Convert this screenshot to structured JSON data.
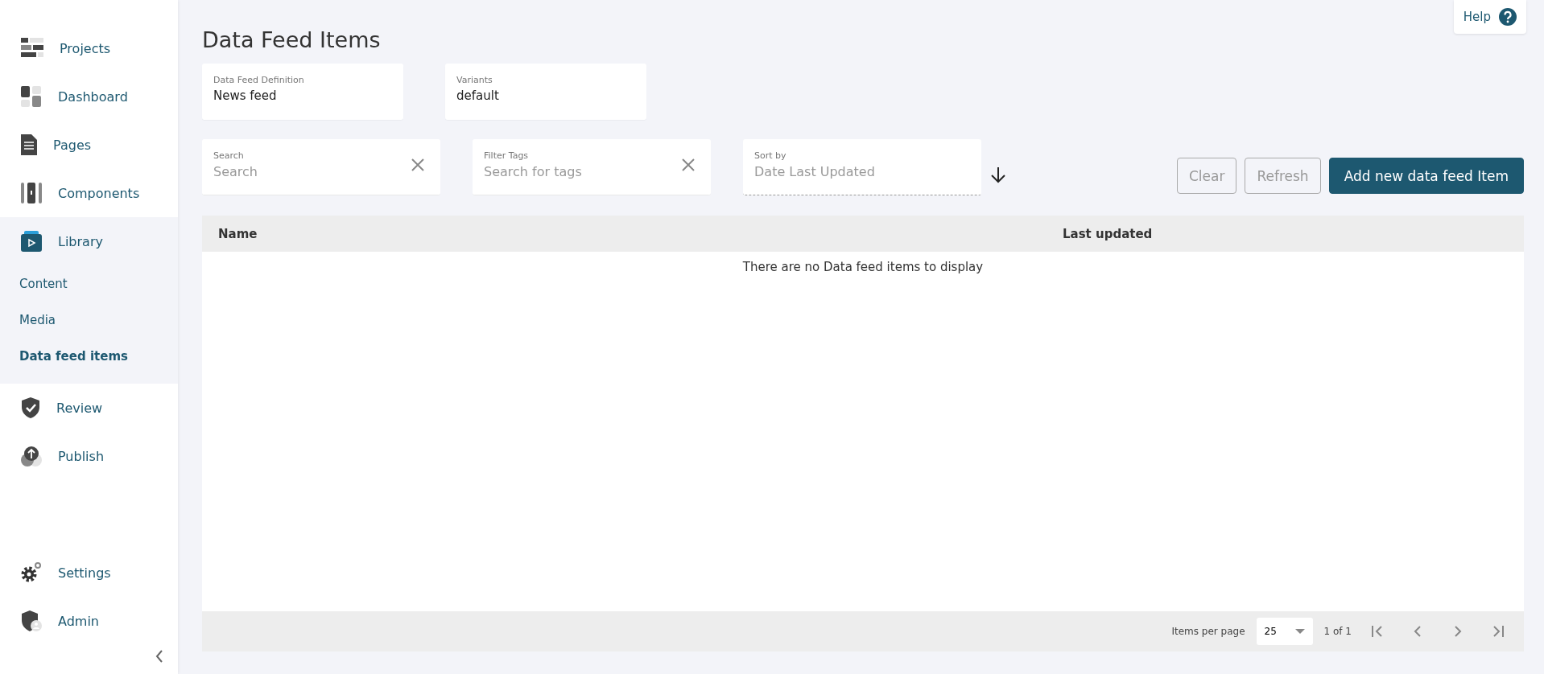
{
  "sidebar": {
    "items": [
      {
        "label": "Projects",
        "expanded": false
      },
      {
        "label": "Dashboard",
        "expanded": false
      },
      {
        "label": "Pages",
        "expanded": false
      },
      {
        "label": "Components",
        "expanded": false
      },
      {
        "label": "Library",
        "expanded": true,
        "children": [
          {
            "label": "Content",
            "selected": false
          },
          {
            "label": "Media",
            "selected": false
          },
          {
            "label": "Data feed items",
            "selected": true
          }
        ]
      },
      {
        "label": "Review",
        "expanded": false
      },
      {
        "label": "Publish",
        "expanded": false
      }
    ],
    "bottom_items": [
      {
        "label": "Settings"
      },
      {
        "label": "Admin"
      }
    ]
  },
  "help": {
    "label": "Help"
  },
  "title": "Data Feed Items",
  "selectors": [
    {
      "label": "Data Feed Definition",
      "value": "News feed"
    },
    {
      "label": "Variants",
      "value": "default"
    }
  ],
  "filters": [
    {
      "kind": "search",
      "label": "Search",
      "placeholder": "Search"
    },
    {
      "kind": "search",
      "label": "Filter Tags",
      "placeholder": "Search for tags"
    },
    {
      "kind": "sort",
      "label": "Sort by",
      "placeholder": "Date Last Updated"
    }
  ],
  "buttons": [
    {
      "label": "Clear",
      "kind": "secondary"
    },
    {
      "label": "Refresh",
      "kind": "secondary"
    },
    {
      "label": "Add new data feed Item",
      "kind": "primary"
    }
  ],
  "table": {
    "columns": [
      "Name",
      "Last updated"
    ],
    "empty_message": "There are no Data feed items to display"
  },
  "pagination": {
    "items_per_page_label": "Items per page",
    "items_per_page": "25",
    "page_info": "1 of 1"
  }
}
